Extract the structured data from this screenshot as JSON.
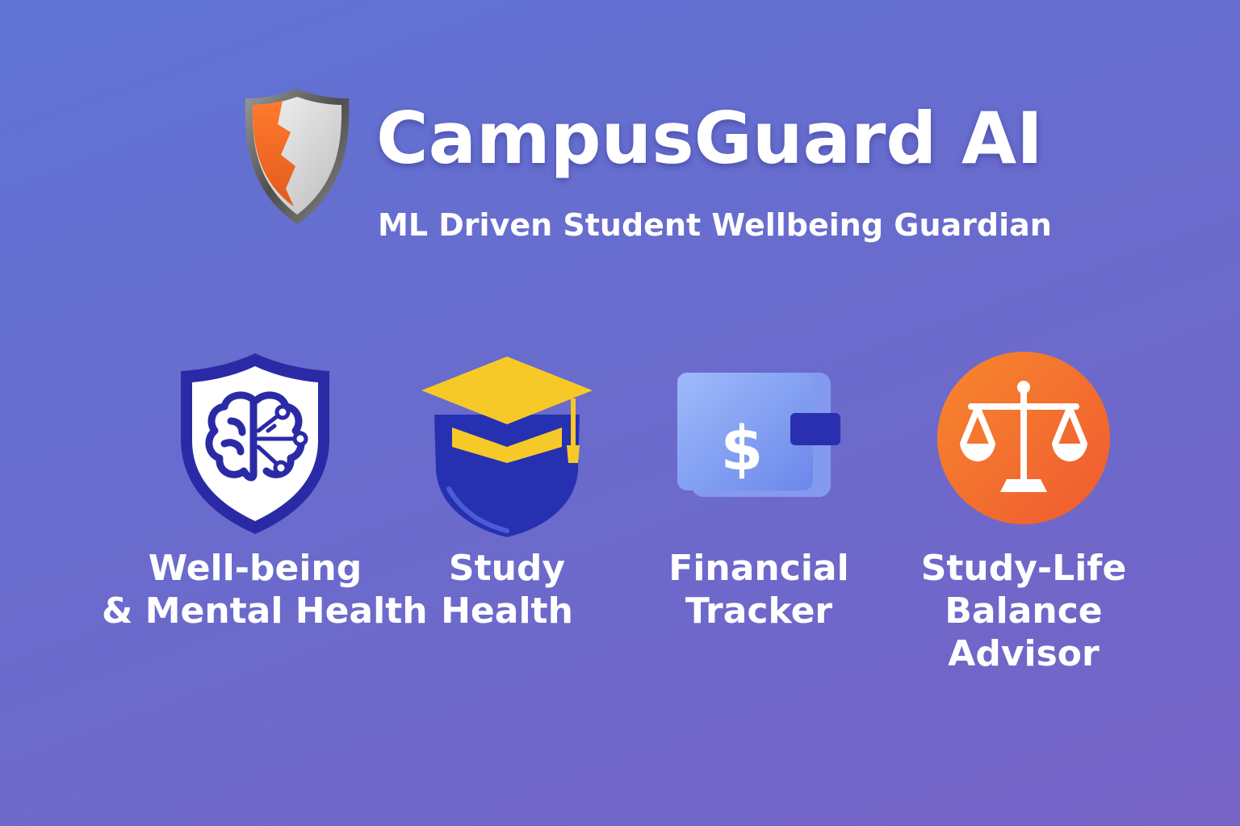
{
  "header": {
    "logo_icon": "shield-icon",
    "title": "CampusGuard AI",
    "subtitle": "ML Driven Student Wellbeing Guardian"
  },
  "features": [
    {
      "icon": "brain-shield-icon",
      "label_lines": [
        "Well-being",
        "& Mental Health"
      ]
    },
    {
      "icon": "graduation-cap-shield-icon",
      "label_lines": [
        "Study",
        "Health"
      ]
    },
    {
      "icon": "wallet-dollar-icon",
      "label_lines": [
        "Financial",
        "Tracker"
      ]
    },
    {
      "icon": "balance-scale-icon",
      "label_lines": [
        "Study-Life",
        "Balance",
        "Advisor"
      ]
    }
  ],
  "colors": {
    "background_start": "#5f73d4",
    "background_end": "#7663c6",
    "logo_orange": "#f26a2a",
    "brain_shield_navy": "#2b2aa6",
    "cap_yellow": "#f7c928",
    "wallet_blue": "#7b9cf2",
    "scale_orange": "#f3702e"
  }
}
